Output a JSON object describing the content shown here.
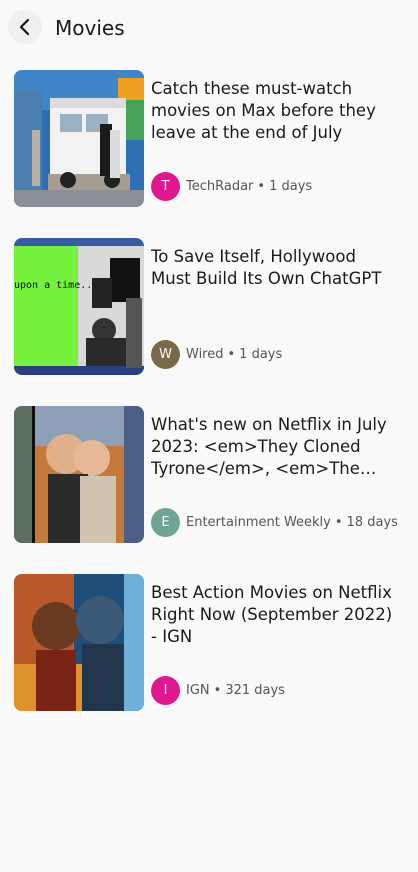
{
  "header": {
    "back_icon": "back-arrow-icon",
    "title": "Movies"
  },
  "articles": [
    {
      "headline": "Catch these must-watch movies on Max before they leave at the end of July",
      "avatar_letter": "T",
      "avatar_color": "#e0188f",
      "source": "TechRadar",
      "separator": "•",
      "age": "1 days",
      "thumbnail": "food-truck-photo"
    },
    {
      "headline": "To Save Itself, Hollywood Must Build Its Own ChatGPT",
      "avatar_letter": "W",
      "avatar_color": "#7a6a4a",
      "source": "Wired",
      "separator": "•",
      "age": "1 days",
      "thumbnail": "strike-collage-photo",
      "thumbnail_text": "upon a time..."
    },
    {
      "headline": "What's new on Netflix in July 2023: <em>They Cloned Tyrone</em>, <em>The Witcher</em>",
      "avatar_letter": "E",
      "avatar_color": "#6fa396",
      "source": "Entertainment Weekly",
      "separator": "•",
      "age": "18 days",
      "thumbnail": "couple-still-photo"
    },
    {
      "headline": "Best Action Movies on Netflix Right Now (September 2022) - IGN",
      "avatar_letter": "I",
      "avatar_color": "#e0188f",
      "source": "IGN",
      "separator": "•",
      "age": "321 days",
      "thumbnail": "action-poster-photo"
    }
  ]
}
